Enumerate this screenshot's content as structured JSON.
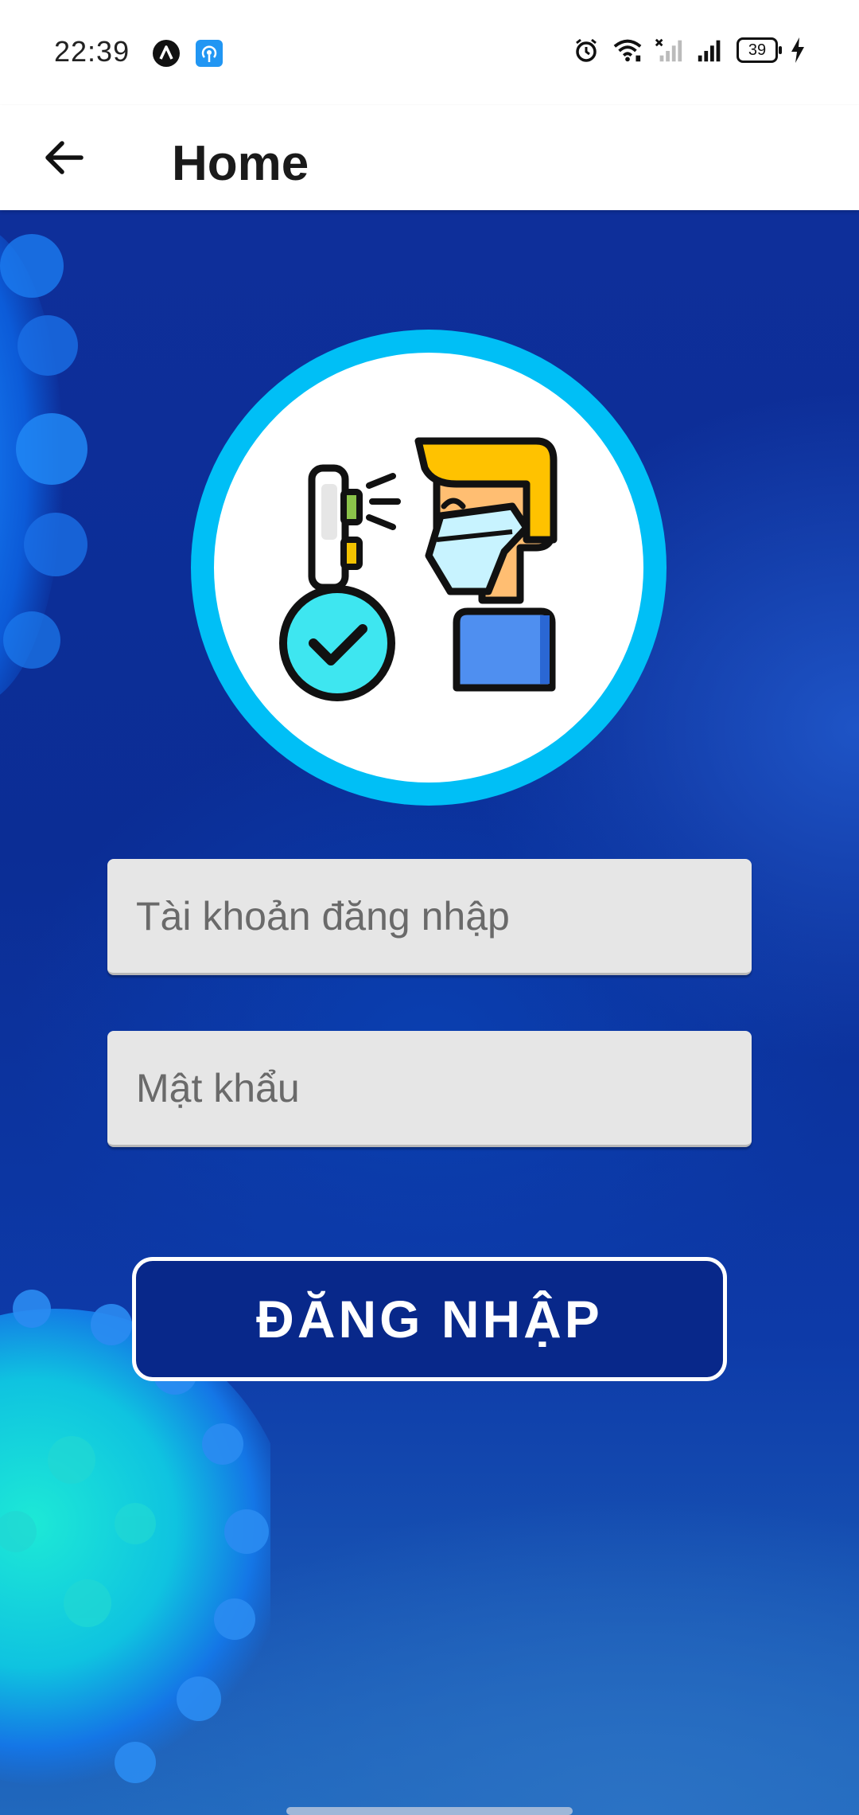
{
  "status_bar": {
    "time": "22:39",
    "battery_level": "39",
    "icons": [
      "app-a-icon",
      "hotspot-icon",
      "alarm-icon",
      "wifi-icon",
      "sim-no-signal-icon",
      "cell-signal-icon",
      "battery-icon",
      "charging-icon"
    ]
  },
  "app_bar": {
    "title": "Home",
    "back_icon": "arrow-left-icon"
  },
  "login_form": {
    "emblem_icon": "temperature-check-person-icon",
    "username_placeholder": "Tài khoản đăng nhập",
    "password_placeholder": "Mật khẩu",
    "submit_label": "ĐĂNG NHẬP"
  },
  "colors": {
    "background": "#0b2d95",
    "emblem_ring": "#00bff6",
    "button_fill": "#08288a",
    "field_fill": "#e6e6e6"
  }
}
